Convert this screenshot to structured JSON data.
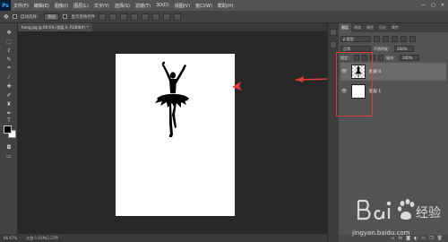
{
  "app": {
    "logo": "Ps",
    "window_controls": [
      "—",
      "▢",
      "✕"
    ]
  },
  "menu": [
    "文件(F)",
    "编辑(E)",
    "图像(I)",
    "图层(L)",
    "文字(Y)",
    "选择(S)",
    "滤镜(T)",
    "3D(D)",
    "视图(V)",
    "窗口(W)",
    "帮助(H)"
  ],
  "options": {
    "auto_select_label": "自动选择：",
    "auto_select_value": "图层",
    "transform_label": "显示变换控件"
  },
  "document": {
    "tab_label": "hong.jpg @ 66.6% (图层 0, RGB/8#) *",
    "zoom": "66.67%",
    "doc_info": "文档:1.91M/2.27M"
  },
  "panel": {
    "tabs": [
      "图层",
      "通道",
      "路径",
      "历史",
      "属性"
    ],
    "kind_filter": "ρ 类型",
    "blend_mode": "正常",
    "opacity_label": "不透明度：",
    "opacity_value": "100%",
    "lock_label": "锁定：",
    "fill_label": "填充：",
    "fill_value": "100%",
    "layers": [
      {
        "name": "图层 0",
        "visible": true,
        "thumb": "silhouette"
      },
      {
        "name": "图层 1",
        "visible": true,
        "thumb": "white"
      }
    ],
    "footer_icons": [
      "link-icon",
      "fx-icon",
      "mask-icon",
      "adjust-icon",
      "folder-icon",
      "new-layer-icon",
      "trash-icon"
    ]
  },
  "annotations": {
    "highlight_color": "#e03c3c"
  },
  "watermark": {
    "brand": "Bai 经验",
    "url": "jingyan.baidu.com"
  }
}
